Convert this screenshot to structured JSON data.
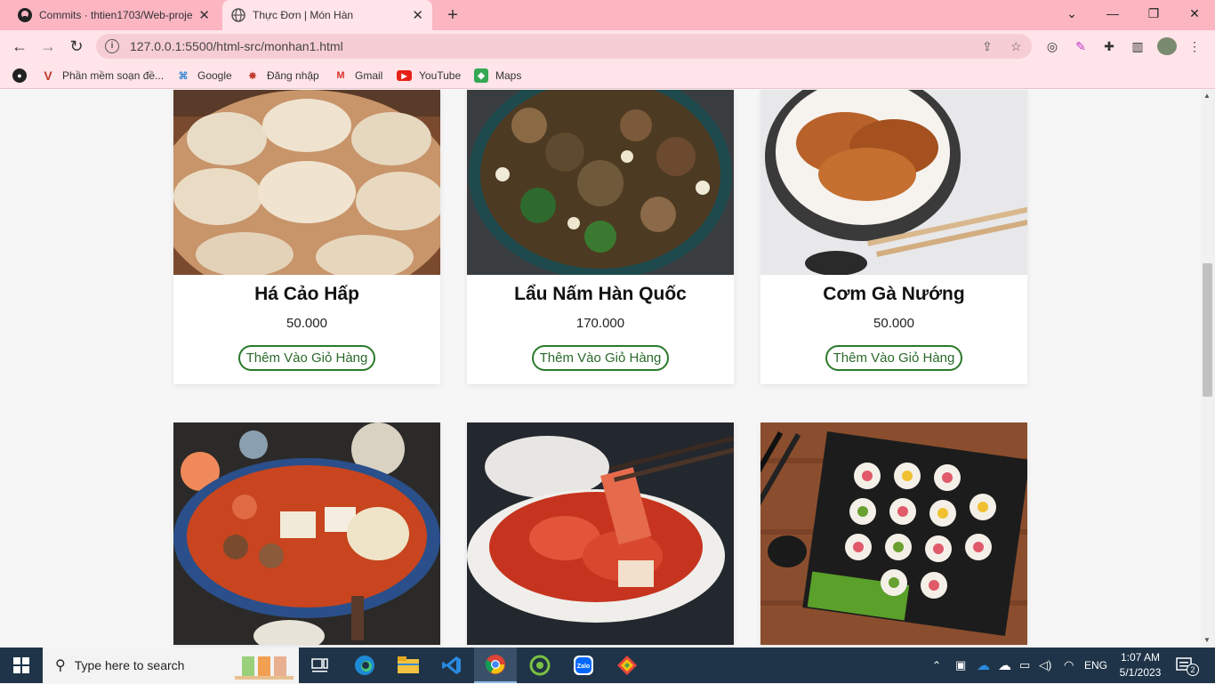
{
  "browser": {
    "tabs": [
      {
        "title": "Commits · thtien1703/Web-proje",
        "active": false
      },
      {
        "title": "Thực Đơn | Món Hàn",
        "active": true
      }
    ],
    "url": "127.0.0.1:5500/html-src/monhan1.html",
    "bookmarks": [
      {
        "label": "Phần mềm soạn đề..."
      },
      {
        "label": "Google"
      },
      {
        "label": "Đăng nhập"
      },
      {
        "label": "Gmail"
      },
      {
        "label": "YouTube"
      },
      {
        "label": "Maps"
      }
    ]
  },
  "menu": {
    "items": [
      {
        "name": "Há Cảo Hấp",
        "price": "50.000",
        "button": "Thêm Vào Giỏ Hàng"
      },
      {
        "name": "Lẩu Nấm Hàn Quốc",
        "price": "170.000",
        "button": "Thêm Vào Giỏ Hàng"
      },
      {
        "name": "Cơm Gà Nướng",
        "price": "50.000",
        "button": "Thêm Vào Giỏ Hàng"
      }
    ]
  },
  "taskbar": {
    "search_placeholder": "Type here to search",
    "language": "ENG",
    "time": "1:07 AM",
    "date": "5/1/2023",
    "notification_count": "2"
  },
  "colors": {
    "tab_bar": "#fbb6c2",
    "toolbar": "#ffe4e9",
    "button_border": "#2a7a2a",
    "taskbar": "#1f3448"
  }
}
